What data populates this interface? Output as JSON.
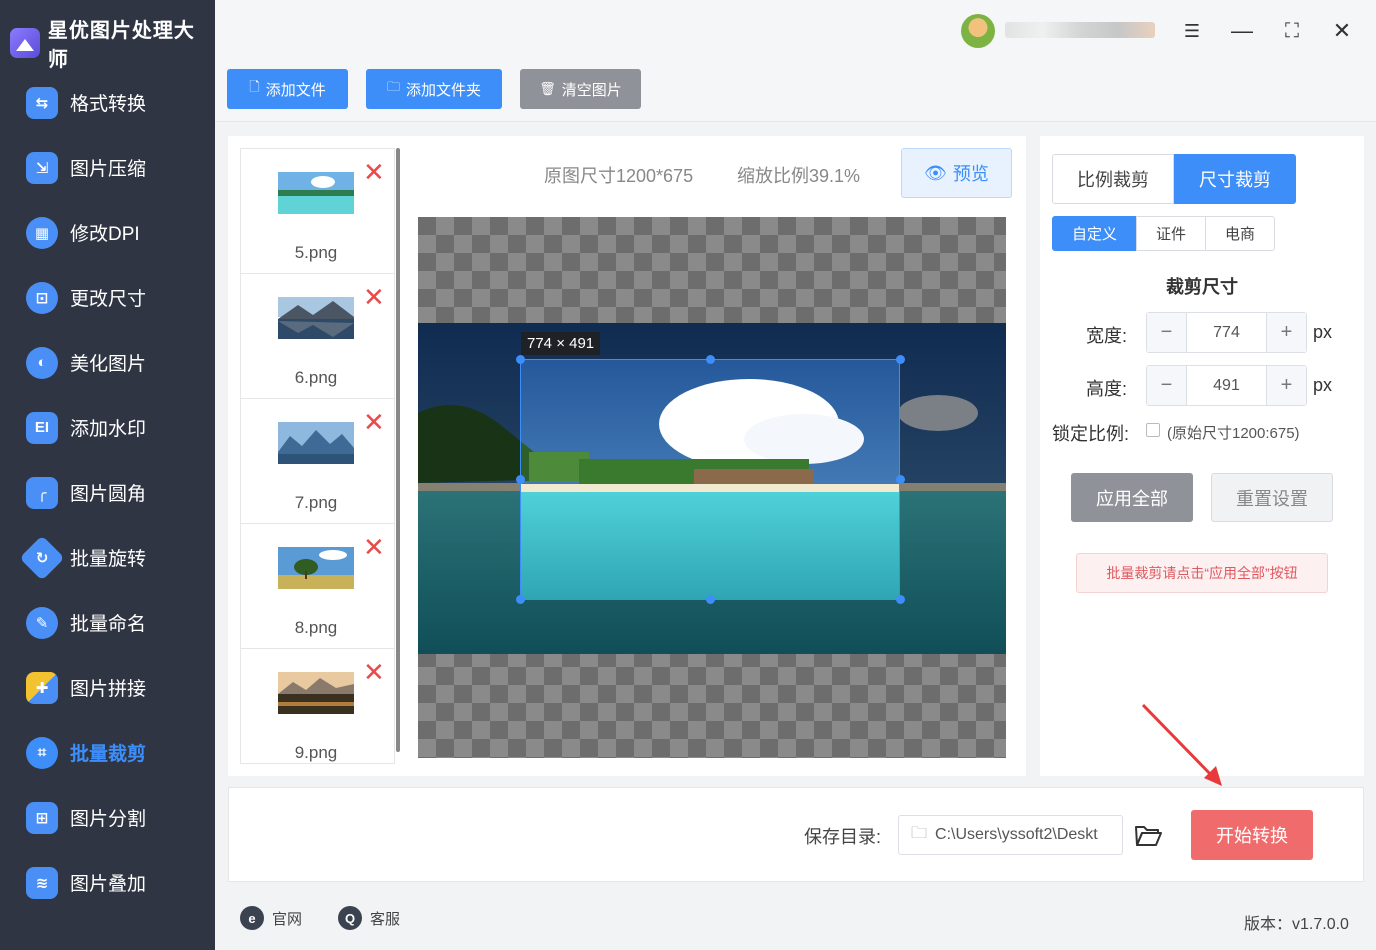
{
  "app": {
    "title": "星优图片处理大师"
  },
  "sidebar": {
    "items": [
      {
        "label": "格式转换",
        "icon": "image-convert-icon",
        "color": "#4a8ff5"
      },
      {
        "label": "图片压缩",
        "icon": "image-compress-icon",
        "color": "#4a8ff5"
      },
      {
        "label": "修改DPI",
        "icon": "dpi-icon",
        "color": "#4a8ff5"
      },
      {
        "label": "更改尺寸",
        "icon": "resize-icon",
        "color": "#4a8ff5"
      },
      {
        "label": "美化图片",
        "icon": "beautify-icon",
        "color": "#4a8ff5"
      },
      {
        "label": "添加水印",
        "icon": "watermark-icon",
        "color": "#4a8ff5"
      },
      {
        "label": "图片圆角",
        "icon": "round-corner-icon",
        "color": "#4a8ff5"
      },
      {
        "label": "批量旋转",
        "icon": "rotate-icon",
        "color": "#4a8ff5"
      },
      {
        "label": "批量命名",
        "icon": "rename-icon",
        "color": "#4a8ff5"
      },
      {
        "label": "图片拼接",
        "icon": "puzzle-icon",
        "color": "#4a8ff5"
      },
      {
        "label": "批量裁剪",
        "icon": "crop-icon",
        "color": "#3d8ef8",
        "active": true
      },
      {
        "label": "图片分割",
        "icon": "split-icon",
        "color": "#4a8ff5"
      },
      {
        "label": "图片叠加",
        "icon": "layers-icon",
        "color": "#4a8ff5"
      }
    ]
  },
  "toolbar": {
    "add_file": "添加文件",
    "add_folder": "添加文件夹",
    "clear": "清空图片"
  },
  "files": [
    {
      "name": "5.png",
      "thumb": "beach"
    },
    {
      "name": "6.png",
      "thumb": "lake"
    },
    {
      "name": "7.png",
      "thumb": "mountains"
    },
    {
      "name": "8.png",
      "thumb": "tree"
    },
    {
      "name": "9.png",
      "thumb": "sunset"
    }
  ],
  "preview": {
    "original_size": "原图尺寸1200*675",
    "zoom": "缩放比例39.1%",
    "preview_btn": "预览",
    "crop_label": "774 × 491"
  },
  "settings": {
    "mode_ratio": "比例裁剪",
    "mode_size": "尺寸裁剪",
    "tabs": [
      "自定义",
      "证件",
      "电商"
    ],
    "section_title": "裁剪尺寸",
    "width_label": "宽度:",
    "width_value": "774",
    "height_label": "高度:",
    "height_value": "491",
    "unit": "px",
    "lock_label": "锁定比例:",
    "lock_hint": "(原始尺寸1200:675)",
    "apply_all": "应用全部",
    "reset": "重置设置",
    "tip": "批量裁剪请点击“应用全部”按钮"
  },
  "bottom": {
    "save_label": "保存目录:",
    "save_path": "C:\\Users\\yssoft2\\Deskt",
    "start": "开始转换"
  },
  "footer": {
    "website": "官网",
    "service": "客服",
    "version": "版本：v1.7.0.0"
  }
}
